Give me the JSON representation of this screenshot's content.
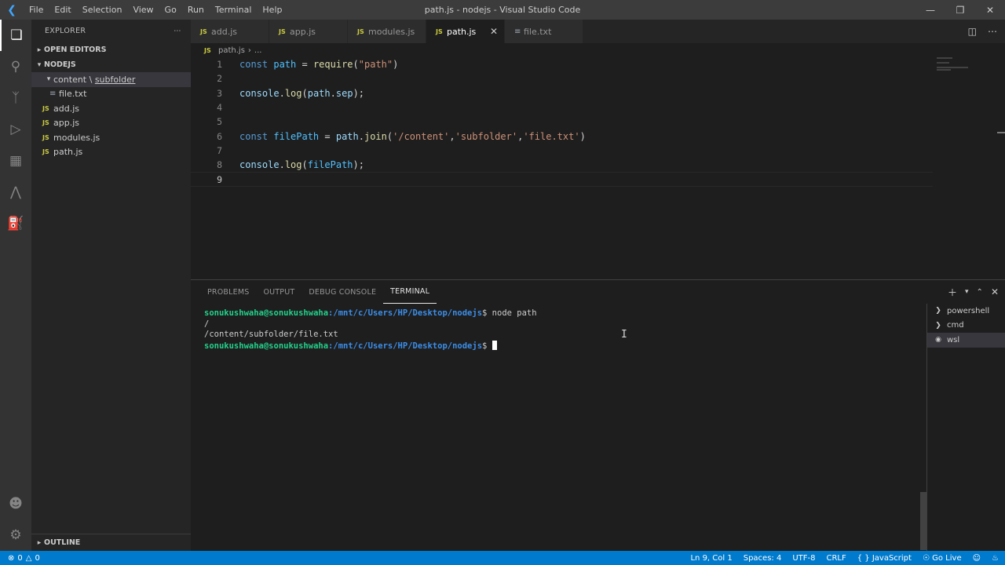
{
  "app": {
    "window_title": "path.js - nodejs - Visual Studio Code",
    "menu": [
      "File",
      "Edit",
      "Selection",
      "View",
      "Go",
      "Run",
      "Terminal",
      "Help"
    ]
  },
  "sidebar": {
    "title": "EXPLORER",
    "open_editors": "OPEN EDITORS",
    "root": "NODEJS",
    "folder_prefix": "content \\ ",
    "folder_sub": "subfolder",
    "files": {
      "file_txt": "file.txt",
      "add": "add.js",
      "app": "app.js",
      "modules": "modules.js",
      "path": "path.js"
    },
    "outline": "OUTLINE"
  },
  "tabs": [
    "add.js",
    "app.js",
    "modules.js",
    "path.js",
    "file.txt"
  ],
  "breadcrumb": {
    "file": "path.js",
    "rest": "..."
  },
  "editor": {
    "line_numbers": [
      "1",
      "2",
      "3",
      "4",
      "5",
      "6",
      "7",
      "8",
      "9"
    ],
    "line1": {
      "kw": "const",
      "var": "path",
      "op": " = ",
      "fn": "require",
      "str": "\"path\""
    },
    "line3": {
      "obj": "console",
      "fn": "log",
      "arg_obj": "path",
      "arg_prop": "sep"
    },
    "line6": {
      "kw": "const",
      "var": "filePath",
      "obj": "path",
      "fn": "join",
      "s1": "'/content'",
      "s2": "'subfolder'",
      "s3": "'file.txt'"
    },
    "line8": {
      "obj": "console",
      "fn": "log",
      "arg": "filePath"
    }
  },
  "panel": {
    "tabs": [
      "PROBLEMS",
      "OUTPUT",
      "DEBUG CONSOLE",
      "TERMINAL"
    ],
    "terminal": {
      "user": "sonukushwaha@sonukushwaha",
      "path": ":/mnt/c/Users/HP/Desktop/nodejs",
      "prompt": "$ ",
      "command": "node path",
      "output1": "/",
      "output2": "/content/subfolder/file.txt"
    },
    "terminal_list": [
      "powershell",
      "cmd",
      "wsl"
    ]
  },
  "statusbar": {
    "errors": "0",
    "warnings": "0",
    "position": "Ln 9, Col 1",
    "spaces": "Spaces: 4",
    "encoding": "UTF-8",
    "eol": "CRLF",
    "language": "JavaScript",
    "golive": "Go Live"
  }
}
